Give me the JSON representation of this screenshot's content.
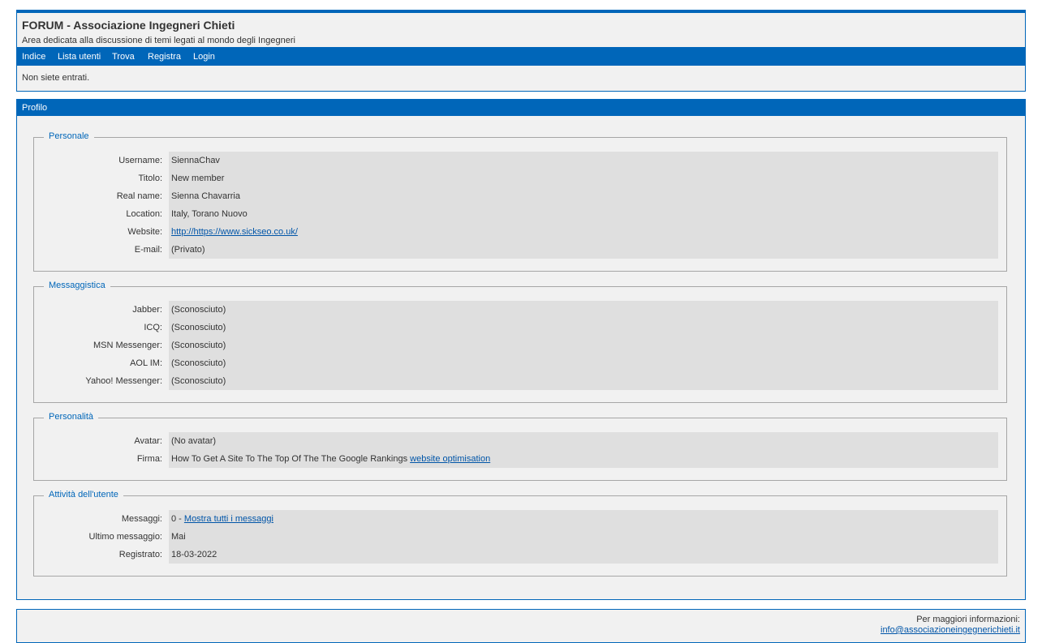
{
  "header": {
    "title": "FORUM - Associazione Ingegneri Chieti",
    "description": "Area dedicata alla discussione di temi legati al mondo degli Ingegneri",
    "nav": [
      "Indice",
      "Lista utenti",
      "Trova",
      "Registra",
      "Login"
    ],
    "status": "Non siete entrati."
  },
  "profile": {
    "bar_title": "Profilo",
    "personale": {
      "legend": "Personale",
      "rows": [
        {
          "label": "Username:",
          "value": "SiennaChav"
        },
        {
          "label": "Titolo:",
          "value": "New member"
        },
        {
          "label": "Real name:",
          "value": "Sienna Chavarria"
        },
        {
          "label": "Location:",
          "value": "Italy, Torano Nuovo"
        },
        {
          "label": "Website:",
          "value": "http://https://www.sickseo.co.uk/"
        },
        {
          "label": "E-mail:",
          "value": "(Privato)"
        }
      ]
    },
    "messaggistica": {
      "legend": "Messaggistica",
      "rows": [
        {
          "label": "Jabber:",
          "value": "(Sconosciuto)"
        },
        {
          "label": "ICQ:",
          "value": "(Sconosciuto)"
        },
        {
          "label": "MSN Messenger:",
          "value": "(Sconosciuto)"
        },
        {
          "label": "AOL IM:",
          "value": "(Sconosciuto)"
        },
        {
          "label": "Yahoo! Messenger:",
          "value": "(Sconosciuto)"
        }
      ]
    },
    "personalita": {
      "legend": "Personalità",
      "avatar_label": "Avatar:",
      "avatar_value": "(No avatar)",
      "firma_label": "Firma:",
      "firma_text": "How To Get A Site To The Top Of The The Google Rankings ",
      "firma_link": "website optimisation"
    },
    "attivita": {
      "legend": "Attività dell'utente",
      "messaggi_label": "Messaggi:",
      "messaggi_count": "0 - ",
      "messaggi_link": "Mostra tutti i messaggi",
      "ultimo_label": "Ultimo messaggio:",
      "ultimo_value": "Mai",
      "registrato_label": "Registrato:",
      "registrato_value": "18-03-2022"
    }
  },
  "footer": {
    "info_label": "Per maggiori informazioni:",
    "email": "info@associazioneingegnerichieti.it"
  }
}
